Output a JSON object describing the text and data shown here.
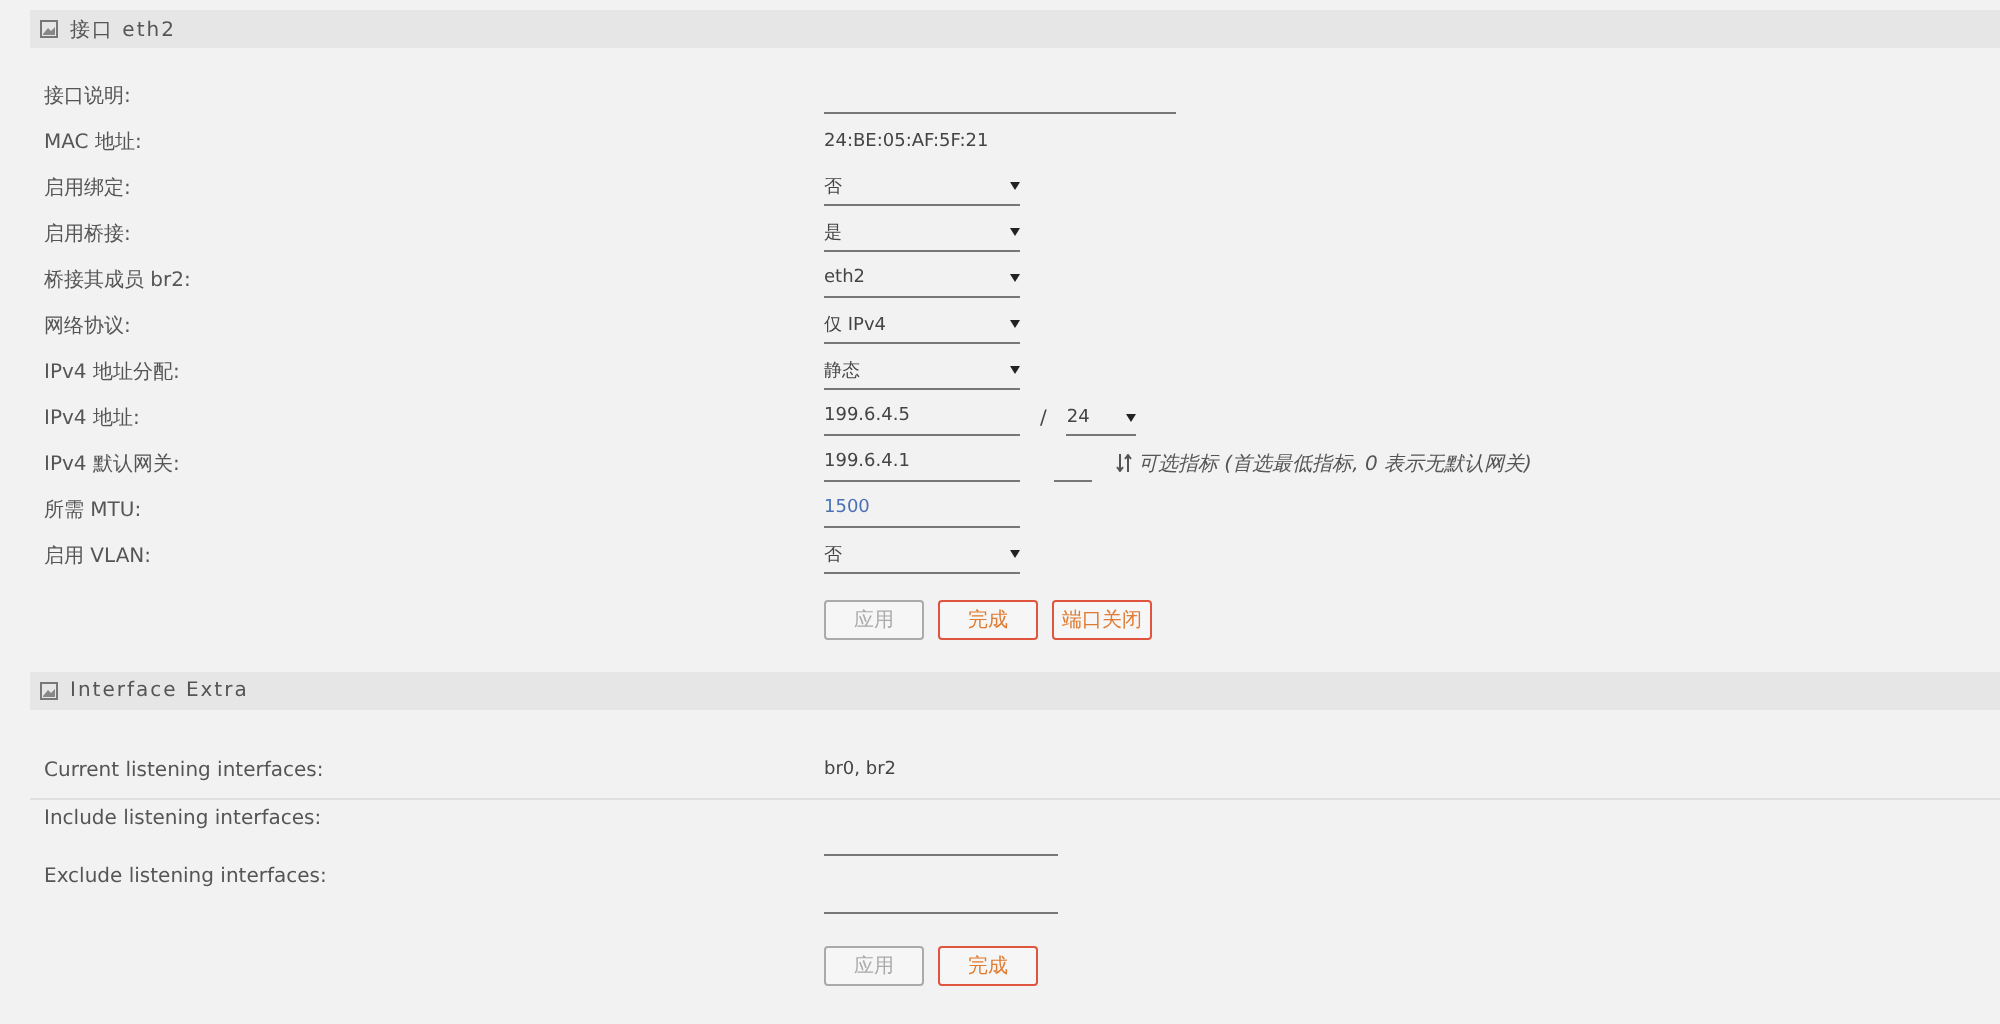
{
  "sections": [
    {
      "title": "接口 eth2",
      "rows": [
        {
          "label": "接口说明:",
          "kind": "input"
        },
        {
          "label": "MAC 地址:",
          "kind": "text",
          "value": "24:BE:05:AF:5F:21"
        },
        {
          "label": "启用绑定:",
          "kind": "select",
          "value": "否"
        },
        {
          "label": "启用桥接:",
          "kind": "select",
          "value": "是"
        },
        {
          "label": "桥接其成员 br2:",
          "kind": "select",
          "value": "eth2"
        },
        {
          "label": "网络协议:",
          "kind": "select",
          "value": "仅 IPv4"
        },
        {
          "label": "IPv4 地址分配:",
          "kind": "select",
          "value": "静态"
        },
        {
          "label": "IPv4 地址:",
          "kind": "ipmask",
          "value": "199.6.4.5",
          "separator": "/",
          "mask": "24"
        },
        {
          "label": "IPv4 默认网关:",
          "kind": "gateway",
          "value": "199.6.4.1",
          "hint": "可选指标 (首选最低指标, 0 表示无默认网关)"
        },
        {
          "label": "所需 MTU:",
          "kind": "input",
          "placeholder": "1500"
        },
        {
          "label": "启用 VLAN:",
          "kind": "select",
          "value": "否"
        }
      ],
      "buttons": [
        {
          "label": "应用",
          "disabled": true
        },
        {
          "label": "完成",
          "disabled": false
        },
        {
          "label": "端口关闭",
          "disabled": false
        }
      ]
    },
    {
      "title": "Interface Extra",
      "rows": [
        {
          "label": "Current listening interfaces:",
          "kind": "text",
          "value": "br0, br2"
        },
        {
          "label": "Include listening interfaces:",
          "kind": "input"
        },
        {
          "label": "Exclude listening interfaces:",
          "kind": "input"
        }
      ],
      "buttons": [
        {
          "label": "应用",
          "disabled": true
        },
        {
          "label": "完成",
          "disabled": false
        }
      ]
    }
  ]
}
